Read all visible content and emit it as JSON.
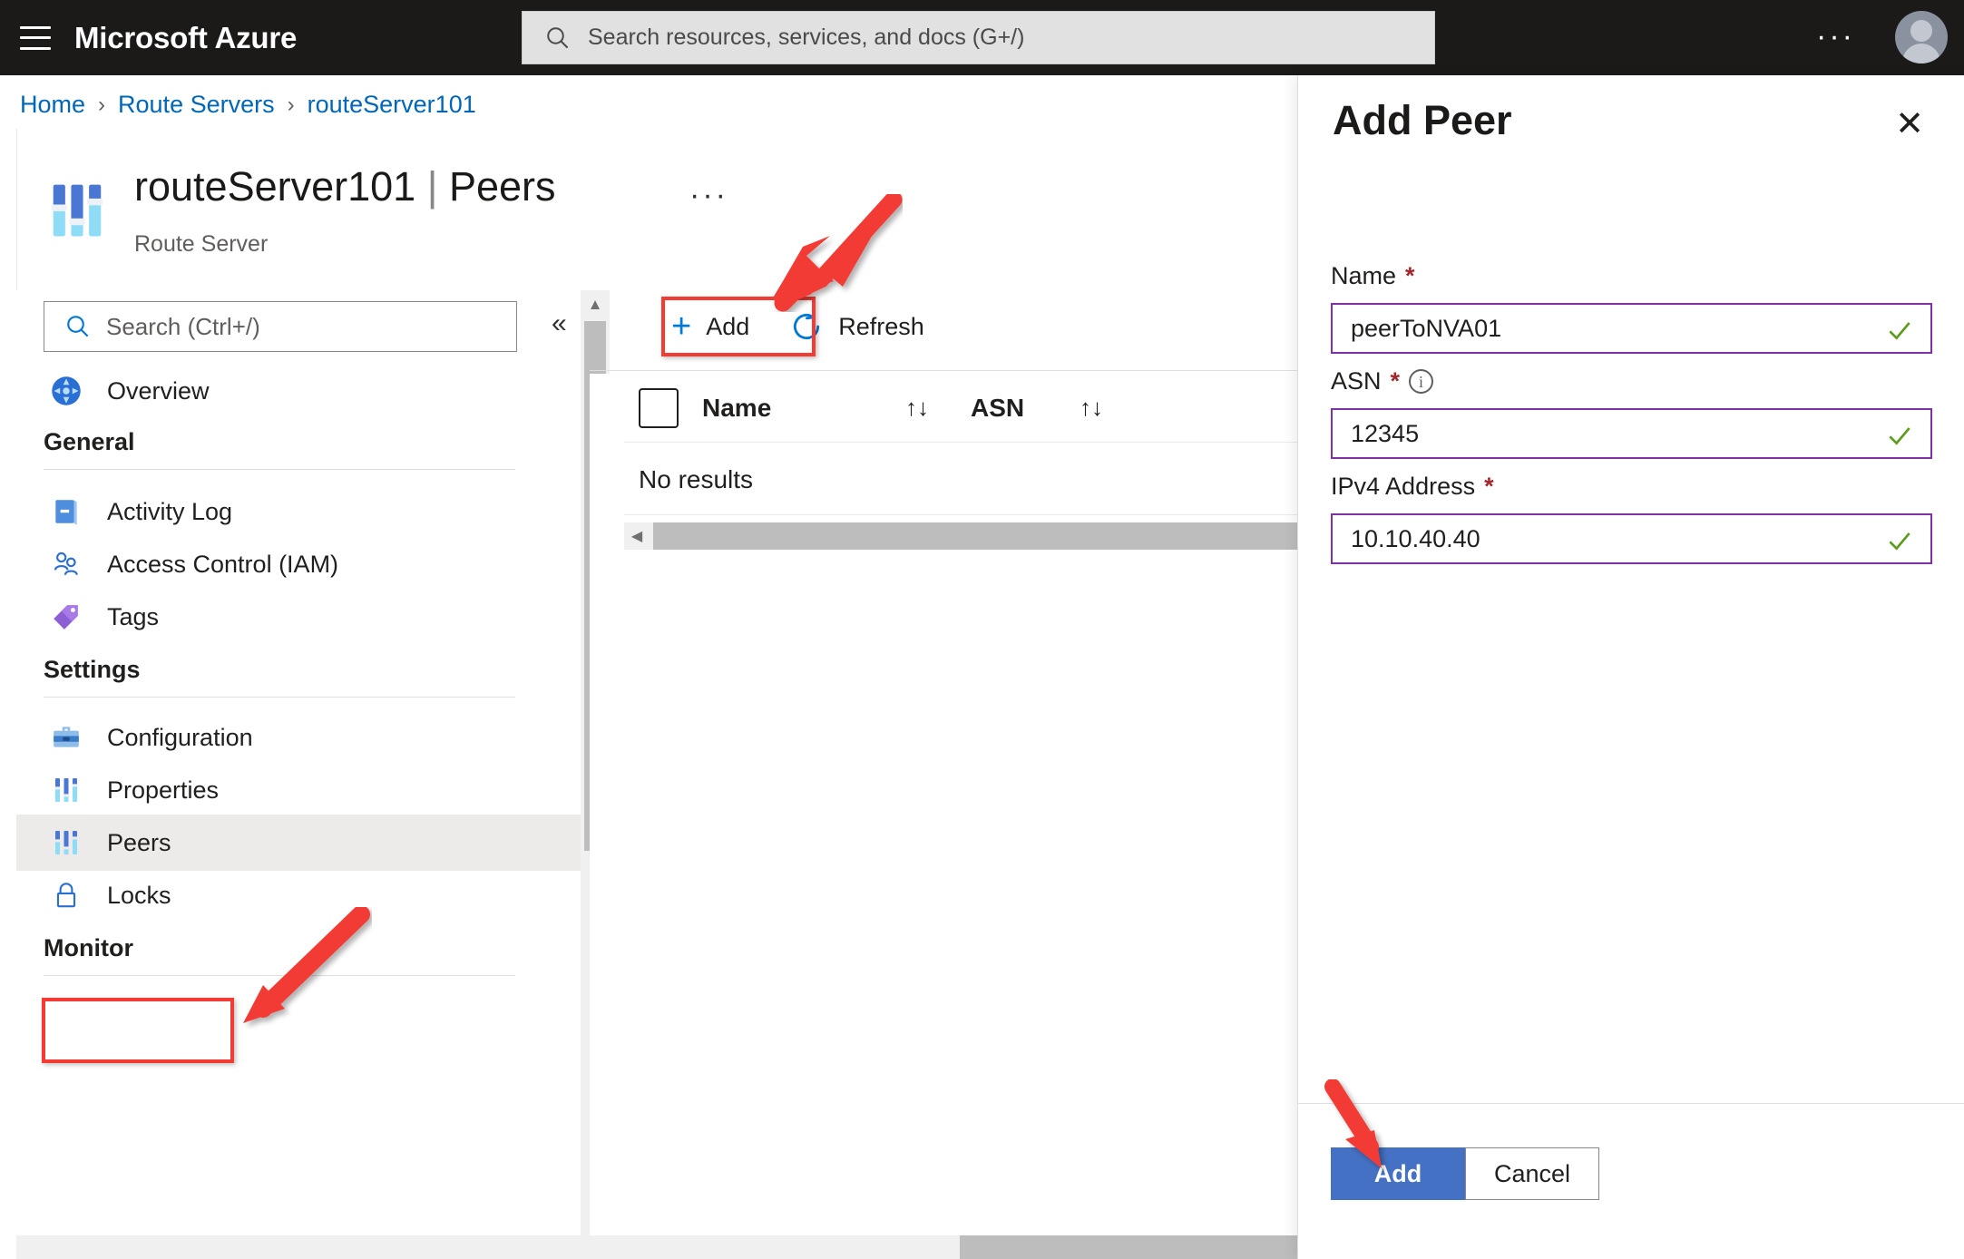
{
  "topbar": {
    "menu_icon": "hamburger-icon",
    "brand": "Microsoft Azure",
    "search_placeholder": "Search resources, services, and docs (G+/)",
    "search_icon": "search-icon",
    "ellipsis": "···",
    "avatar_icon": "user-avatar-icon"
  },
  "breadcrumb": {
    "items": [
      "Home",
      "Route Servers",
      "routeServer101"
    ],
    "separator": "›"
  },
  "page": {
    "resource_name": "routeServer101",
    "divider": "|",
    "blade_name": "Peers",
    "subtitle": "Route Server",
    "icon": "route-server-sliders-icon",
    "ellipsis": "···"
  },
  "nav": {
    "search_placeholder": "Search (Ctrl+/)",
    "search_icon": "search-icon",
    "overview": {
      "label": "Overview",
      "icon": "overview-compass-icon"
    },
    "groups": [
      {
        "title": "General",
        "items": [
          {
            "label": "Activity Log",
            "icon": "activity-log-icon"
          },
          {
            "label": "Access Control (IAM)",
            "icon": "access-control-people-icon"
          },
          {
            "label": "Tags",
            "icon": "tags-icon"
          }
        ]
      },
      {
        "title": "Settings",
        "items": [
          {
            "label": "Configuration",
            "icon": "configuration-toolbox-icon"
          },
          {
            "label": "Properties",
            "icon": "properties-sliders-icon"
          },
          {
            "label": "Peers",
            "icon": "peers-sliders-icon",
            "selected": true
          },
          {
            "label": "Locks",
            "icon": "locks-padlock-icon"
          }
        ]
      },
      {
        "title": "Monitor",
        "items": []
      }
    ]
  },
  "toolbar": {
    "collapse_icon": "collapse-chevrons-icon",
    "add_label": "Add",
    "add_icon": "plus-icon",
    "refresh_label": "Refresh",
    "refresh_icon": "refresh-icon"
  },
  "table": {
    "columns": [
      {
        "label": "Name",
        "sort_icon": "sort-arrows-icon"
      },
      {
        "label": "ASN",
        "sort_icon": "sort-arrows-icon"
      }
    ],
    "select_all_icon": "checkbox-icon",
    "empty_message": "No results",
    "rows": []
  },
  "panel": {
    "title": "Add Peer",
    "close_icon": "close-icon",
    "fields": [
      {
        "label": "Name",
        "required_marker": "*",
        "value": "peerToNVA01",
        "valid_icon": "check-icon",
        "has_info": false
      },
      {
        "label": "ASN",
        "required_marker": "*",
        "value": "12345",
        "valid_icon": "check-icon",
        "has_info": true,
        "info_icon": "info-icon",
        "info_glyph": "i"
      },
      {
        "label": "IPv4 Address",
        "required_marker": "*",
        "value": "10.10.40.40",
        "valid_icon": "check-icon",
        "has_info": false
      }
    ],
    "primary_button": "Add",
    "secondary_button": "Cancel"
  },
  "colors": {
    "azure_blue": "#0078d4",
    "link_blue": "#0067b8",
    "topbar_bg": "#1b1a19",
    "annotation_red": "#f33b34",
    "field_border_purple": "#8031a7",
    "valid_green": "#5d9c20",
    "required_red": "#a4262c",
    "primary_button_blue": "#4471c4",
    "selected_row_gray": "#edebe9"
  }
}
